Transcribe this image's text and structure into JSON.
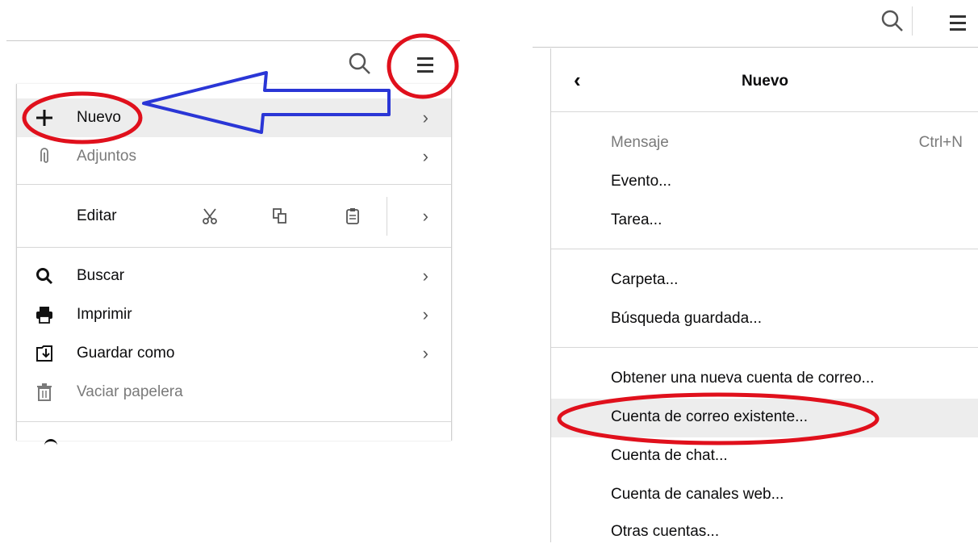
{
  "left_menu": {
    "items": [
      {
        "label": "Nuevo",
        "icon": "plus-icon",
        "has_submenu": true,
        "disabled": false
      },
      {
        "label": "Adjuntos",
        "icon": "paperclip-icon",
        "has_submenu": true,
        "disabled": true
      },
      {
        "label": "Editar",
        "has_submenu": true
      },
      {
        "label": "Buscar",
        "icon": "search-icon",
        "has_submenu": true
      },
      {
        "label": "Imprimir",
        "icon": "printer-icon",
        "has_submenu": true
      },
      {
        "label": "Guardar como",
        "icon": "save-as-icon",
        "has_submenu": true
      },
      {
        "label": "Vaciar papelera",
        "icon": "trash-icon",
        "disabled": true
      }
    ],
    "edit_icons": [
      "scissors-icon",
      "copy-icon",
      "paste-icon"
    ]
  },
  "right_menu": {
    "header_title": "Nuevo",
    "items": [
      {
        "label": "Mensaje",
        "shortcut": "Ctrl+N",
        "disabled": true
      },
      {
        "label": "Evento..."
      },
      {
        "label": "Tarea..."
      },
      {
        "label": "Carpeta..."
      },
      {
        "label": "Búsqueda guardada..."
      },
      {
        "label": "Obtener una nueva cuenta de correo..."
      },
      {
        "label": "Cuenta de correo existente...",
        "highlighted": true
      },
      {
        "label": "Cuenta de chat..."
      },
      {
        "label": "Cuenta de canales web..."
      },
      {
        "label": "Otras cuentas..."
      }
    ]
  },
  "annotations": {
    "circle_color": "#e0101c",
    "arrow_color": "#2a36d6"
  }
}
